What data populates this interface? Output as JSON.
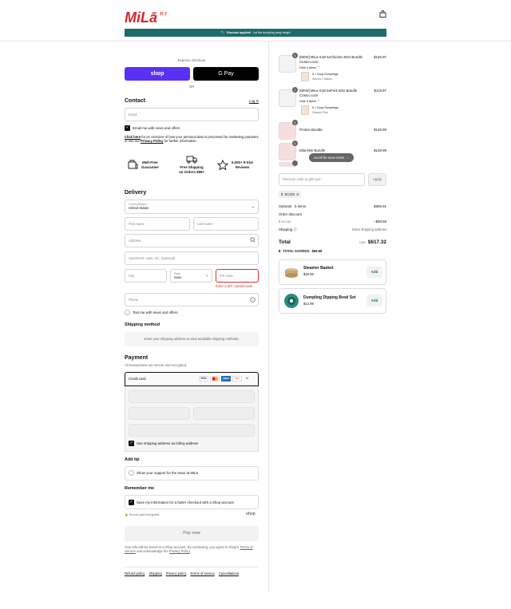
{
  "header": {
    "logo_text": "MiLā",
    "logo_sub": "餃子",
    "banner_text": "Discount applied!",
    "banner_sub": "Let the dumpling party begin!"
  },
  "express": {
    "label": "Express checkout",
    "shop": "shop",
    "gpay": "G Pay",
    "or": "OR"
  },
  "contact": {
    "title": "Contact",
    "login": "Log in",
    "email_placeholder": "Email",
    "news": "Email me with news and offers",
    "privacy_pre": "Click here",
    "privacy_mid": " for an overview of how your personal data is processed for marketing purposes or see our ",
    "privacy_link": "Privacy Policy",
    "privacy_post": " for further information."
  },
  "perks": [
    {
      "icon": "snowflake-icon",
      "l1": "Melt-Free",
      "l2": "Guarantee"
    },
    {
      "icon": "truck-icon",
      "l1": "Free Shipping",
      "l2": "on Orders $99+"
    },
    {
      "icon": "star-icon",
      "l1": "5,000+ 5-Star",
      "l2": "Reviews"
    }
  ],
  "delivery": {
    "title": "Delivery",
    "country_label": "Country/Region",
    "country": "United States",
    "first": "First name",
    "last": "Last name",
    "address": "Address",
    "apt": "Apartment, suite, etc. (optional)",
    "city": "City",
    "state_label": "State",
    "state": "Iowa",
    "zip": "ZIP code",
    "zip_error": "Enter a ZIP / postal code",
    "phone": "Phone",
    "text_me": "Text me with news and offers"
  },
  "shipping": {
    "title": "Shipping method",
    "msg": "Enter your shipping address to view available shipping methods."
  },
  "payment": {
    "title": "Payment",
    "sub": "All transactions are secure and encrypted.",
    "method": "Credit card",
    "cards": [
      "VISA",
      "MC",
      "AMEX",
      "DISC",
      "+4"
    ],
    "billing": "Use shipping address as billing address"
  },
  "tip": {
    "title": "Add tip",
    "text": "Show your support for the team at MiLā"
  },
  "remember": {
    "title": "Remember me",
    "text": "Save my information for a faster checkout with a Shop account",
    "secure": "Secure and encrypted",
    "shop": "shop"
  },
  "pay_now": "Pay now",
  "legal": {
    "pre": "Your info will be saved to a Shop account. By continuing, you agree to Shop's ",
    "tos": "Terms of Service",
    "mid": " and acknowledge the ",
    "pp": "Privacy Policy",
    "post": "."
  },
  "footer_links": [
    "Refund policy",
    "Shipping",
    "Privacy policy",
    "Terms of service",
    "Cancellations"
  ],
  "cart": {
    "items": [
      {
        "qty": "1",
        "name": "[NEW] MiLa XLB 5xChicken 50ct Bundle Costco.com",
        "price": "$125.97",
        "hide": "Hide 3 items",
        "sub_name": "5 × Soup Dumplings",
        "sub_var": "Savory Chicken"
      },
      {
        "qty": "1",
        "name": "[NEW] MiLa XLB 5xPork 50ct Bundle Costco.com",
        "price": "$119.97",
        "hide": "Hide 3 items",
        "sub_name": "5 × Soup Dumplings",
        "sub_var": "Classic Pork"
      },
      {
        "qty": "1",
        "name": "Protein Bundle",
        "price": "$149.99"
      },
      {
        "qty": "1",
        "name": "Mila Mini Bundle",
        "price": "$139.99"
      }
    ],
    "scroll_hint": "Scroll for more items",
    "discount_placeholder": "Discount code or gift card",
    "apply": "Apply",
    "code": "XCJ10",
    "subtotal_label": "Subtotal · 5 items",
    "subtotal": "$685.91",
    "order_discount": "Order discount",
    "disc_code": "XCJ10",
    "disc_amount": "- $68.59",
    "shipping_label": "Shipping",
    "shipping_val": "Enter shipping address",
    "total_label": "Total",
    "currency": "USD",
    "total": "$617.32",
    "savings_label": "TOTAL SAVINGS",
    "savings": "$68.59",
    "upsells": [
      {
        "name": "Steamer Basket",
        "price": "$29.98",
        "add": "Add"
      },
      {
        "name": "Dumpling Dipping Bowl Set",
        "price": "$12.99",
        "add": "Add"
      }
    ]
  }
}
